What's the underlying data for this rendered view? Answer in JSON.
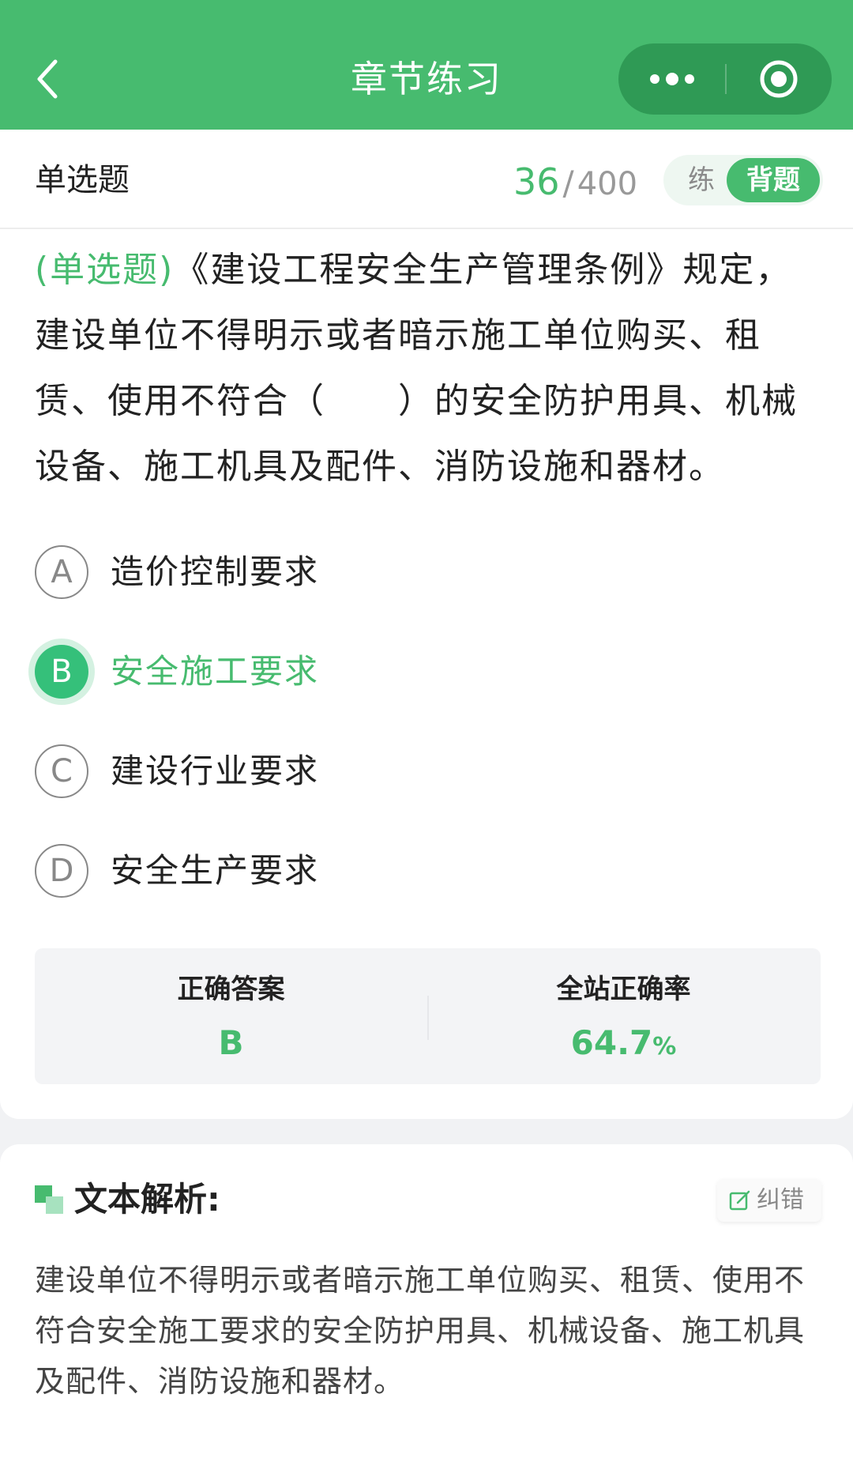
{
  "header": {
    "title": "章节练习",
    "back_icon": "chevron-left-icon",
    "more_icon": "more-dots-icon",
    "close_icon": "target-circle-icon"
  },
  "question_bar": {
    "type_label": "单选题",
    "current": "36",
    "separator": "/",
    "total": "400",
    "mode_practice": "练",
    "mode_recite": "背题"
  },
  "question": {
    "tag": "(单选题)",
    "text": "《建设工程安全生产管理条例》规定，建设单位不得明示或者暗示施工单位购买、租赁、使用不符合（　　）的安全防护用具、机械设备、施工机具及配件、消防设施和器材。"
  },
  "options": [
    {
      "letter": "A",
      "text": "造价控制要求",
      "selected": false
    },
    {
      "letter": "B",
      "text": "安全施工要求",
      "selected": true
    },
    {
      "letter": "C",
      "text": "建设行业要求",
      "selected": false
    },
    {
      "letter": "D",
      "text": "安全生产要求",
      "selected": false
    }
  ],
  "answer": {
    "correct_label": "正确答案",
    "correct_value": "B",
    "rate_label": "全站正确率",
    "rate_value": "64.7",
    "rate_unit": "%"
  },
  "analysis": {
    "title": "文本解析:",
    "correct_button": "纠错",
    "text": "建设单位不得明示或者暗示施工单位购买、租赁、使用不符合安全施工要求的安全防护用具、机械设备、施工机具及配件、消防设施和器材。"
  },
  "colors": {
    "brand": "#47bb6f",
    "selected_option": "#35c07a"
  }
}
